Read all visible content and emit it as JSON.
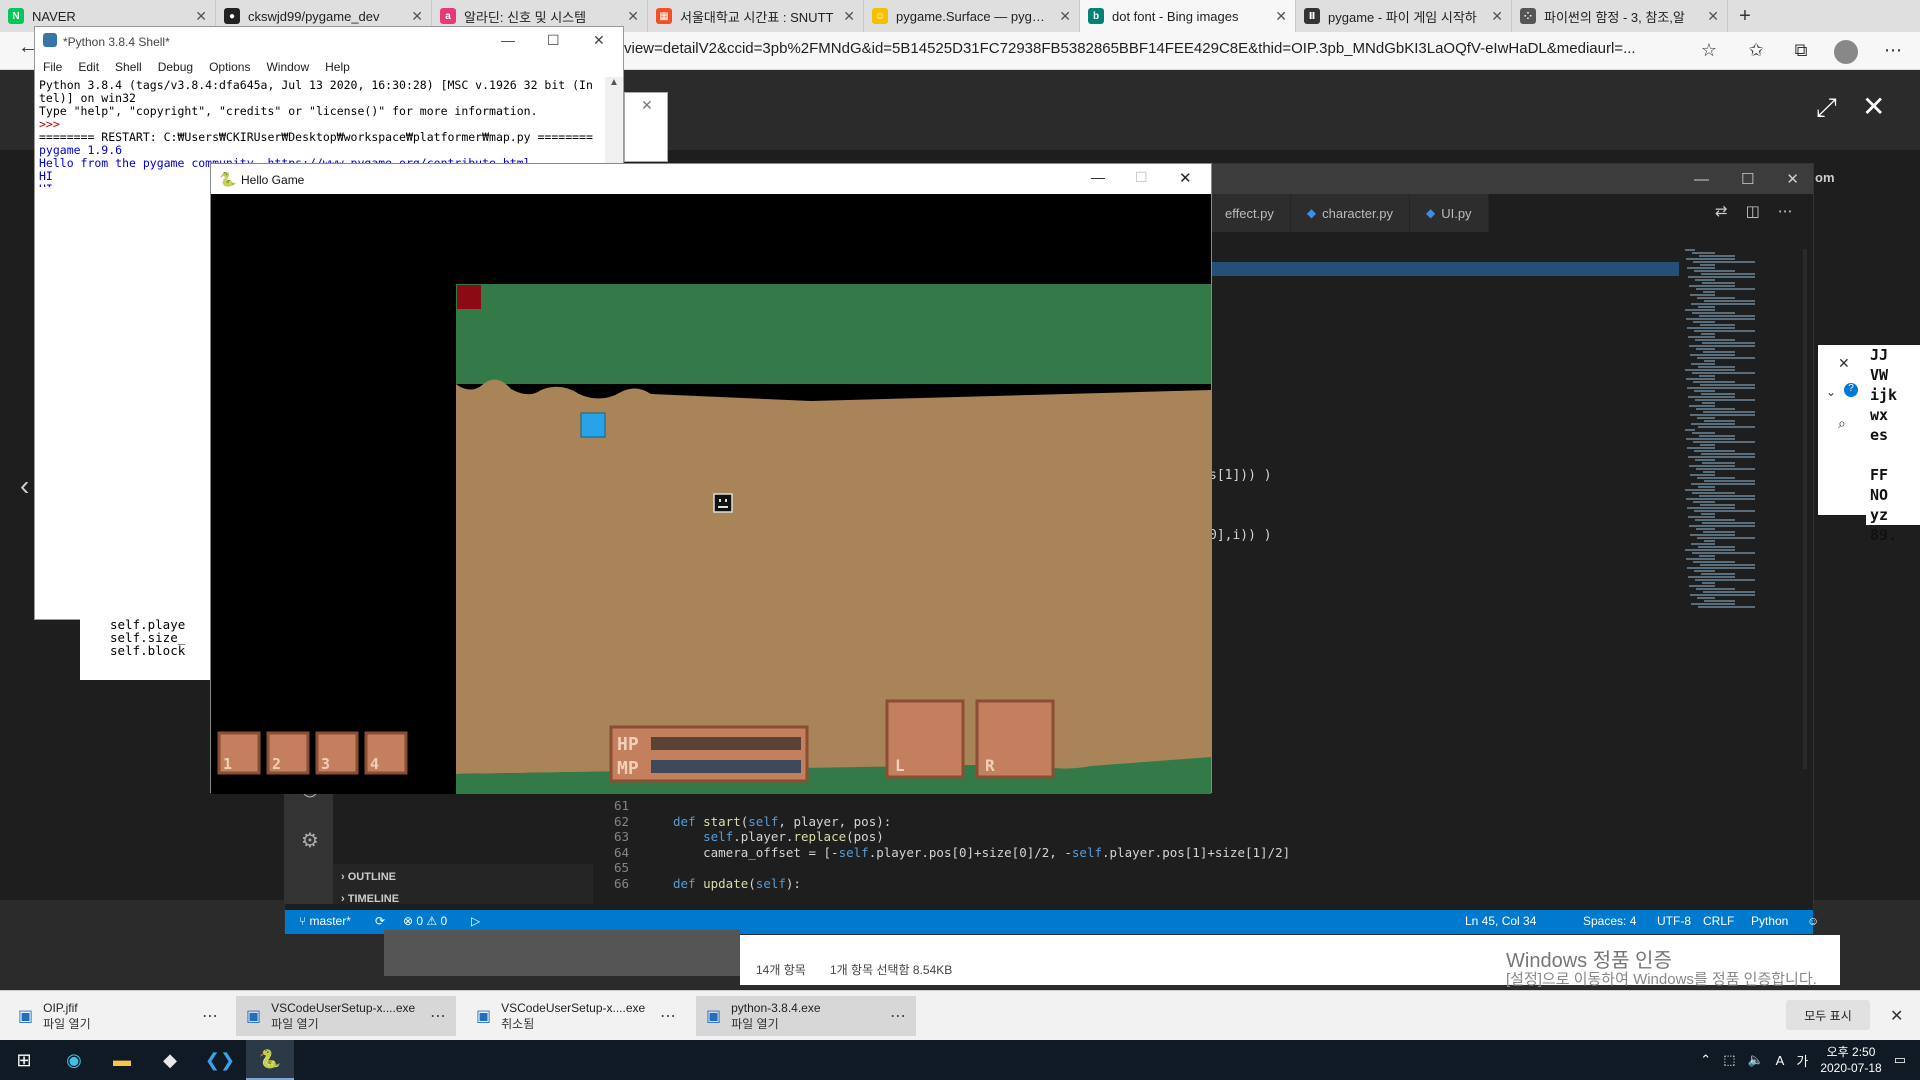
{
  "browser": {
    "tabs": [
      {
        "title": "NAVER",
        "icon": "naver-icon",
        "color": "#03c75a",
        "glyph": "N"
      },
      {
        "title": "ckswjd99/pygame_dev",
        "icon": "github-icon",
        "color": "#222222",
        "glyph": "●"
      },
      {
        "title": "알라딘: 신호 및 시스템",
        "icon": "aladin-icon",
        "color": "#e6397a",
        "glyph": "a"
      },
      {
        "title": "서울대학교 시간표 : SNUTT",
        "icon": "snutt-icon",
        "color": "#f25022",
        "glyph": "▦"
      },
      {
        "title": "pygame.Surface — pygame",
        "icon": "pygame-icon",
        "color": "#f2c200",
        "glyph": "☺"
      },
      {
        "title": "dot font - Bing images",
        "icon": "bing-icon",
        "color": "#008373",
        "glyph": "b",
        "active": true
      },
      {
        "title": "pygame - 파이 게임 시작하",
        "icon": "wikidocs-icon",
        "color": "#333333",
        "glyph": "Ⅱ"
      },
      {
        "title": "파이썬의 함정 - 3, 참조,알",
        "icon": "blog-icon",
        "color": "#555555",
        "glyph": "⁘"
      }
    ],
    "new_tab": "+",
    "url": "view=detailV2&ccid=3pb%2FMNdG&id=5B14525D31FC72938FB5382865BBF14FEE429C8E&thid=OIP.3pb_MNdGbKI3LaOQfV-eIwHaDL&mediaurl=..."
  },
  "shell": {
    "title": "*Python 3.8.4 Shell*",
    "menu": [
      "File",
      "Edit",
      "Shell",
      "Debug",
      "Options",
      "Window",
      "Help"
    ],
    "lines": [
      {
        "t": "Python 3.8.4 (tags/v3.8.4:dfa645a, Jul 13 2020, 16:30:28) [MSC v.1926 32 bit (In",
        "c": ""
      },
      {
        "t": "tel)] on win32",
        "c": ""
      },
      {
        "t": "Type \"help\", \"copyright\", \"credits\" or \"license()\" for more information.",
        "c": ""
      },
      {
        "t": ">>> ",
        "c": "red"
      },
      {
        "t": "======== RESTART: C:₩Users₩CKIRUser₩Desktop₩workspace₩platformer₩map.py ========",
        "c": ""
      },
      {
        "t": "pygame 1.9.6",
        "c": "blue"
      },
      {
        "t": "Hello from the pygame community. https://www.pygame.org/contribute.html",
        "c": "blue"
      },
      {
        "t": "HI",
        "c": "blue"
      },
      {
        "t": "HI",
        "c": "blue"
      },
      {
        "t": "HI",
        "c": "blue"
      },
      {
        "t": "HI",
        "c": "blue"
      },
      {
        "t": "HI",
        "c": "blue"
      }
    ],
    "code_behind": [
      "self.playe",
      "self.size_",
      "self.block"
    ]
  },
  "game": {
    "title": "Hello Game",
    "hotbar": [
      "1",
      "2",
      "3",
      "4"
    ],
    "hp_label": "HP",
    "mp_label": "MP",
    "hp_fill": 1.0,
    "mp_fill": 1.0,
    "l_label": "L",
    "r_label": "R",
    "colors": {
      "grass": "#347a48",
      "dirt": "#a88458",
      "slot": "#c47f5e",
      "slot_border": "#8a4e35",
      "red_block": "#8b0a14",
      "blue_block": "#29a3e8",
      "hp_bar": "#5a4236",
      "mp_bar": "#3d4a5a"
    }
  },
  "vscode": {
    "tabs": [
      {
        "label": "effect.py"
      },
      {
        "label": "character.py"
      },
      {
        "label": "UI.py"
      }
    ],
    "title_partial": "om",
    "code_fragment_1": "s[1])) )",
    "code_fragment_2": "0],i)) )",
    "lines": [
      {
        "n": "61",
        "code": ""
      },
      {
        "n": "62",
        "code": "def start(self, player, pos):"
      },
      {
        "n": "63",
        "code": "    self.player.replace(pos)"
      },
      {
        "n": "64",
        "code": "    camera_offset = [-self.player.pos[0]+size[0]/2, -self.player.pos[1]+size[1]/2]"
      },
      {
        "n": "65",
        "code": ""
      },
      {
        "n": "66",
        "code": "def update(self):"
      }
    ],
    "panels": {
      "outline": "OUTLINE",
      "timeline": "TIMELINE"
    },
    "status": {
      "branch": "master*",
      "problems": "⊗ 0 ⚠ 0",
      "position": "Ln 45, Col 34",
      "spaces": "Spaces: 4",
      "encoding": "UTF-8",
      "eol": "CRLF",
      "language": "Python"
    }
  },
  "explorer": {
    "items_count": "14개 항목",
    "selected": "1개 항목 선택함 8.54KB"
  },
  "watermark": {
    "line1": "Windows 정품 인증",
    "line2": "[설정]으로 이동하여 Windows를 정품 인증합니다."
  },
  "right_glyphs": "JJ\nVW\nijk\nwx\nes\n\nFF\nNO\nyz\n89.",
  "downloads": [
    {
      "name": "OIP.jfif",
      "status": "파일 열기",
      "icon": "image-file-icon"
    },
    {
      "name": "VSCodeUserSetup-x....exe",
      "status": "파일 열기",
      "icon": "vscode-installer-icon"
    },
    {
      "name": "VSCodeUserSetup-x....exe",
      "status": "취소됨",
      "icon": "vscode-installer-icon"
    },
    {
      "name": "python-3.8.4.exe",
      "status": "파일 열기",
      "icon": "python-installer-icon"
    }
  ],
  "show_all": "모두 표시",
  "taskbar": {
    "time": "오후 2:50",
    "date": "2020-07-18",
    "ime": "A",
    "ime2": "가"
  }
}
